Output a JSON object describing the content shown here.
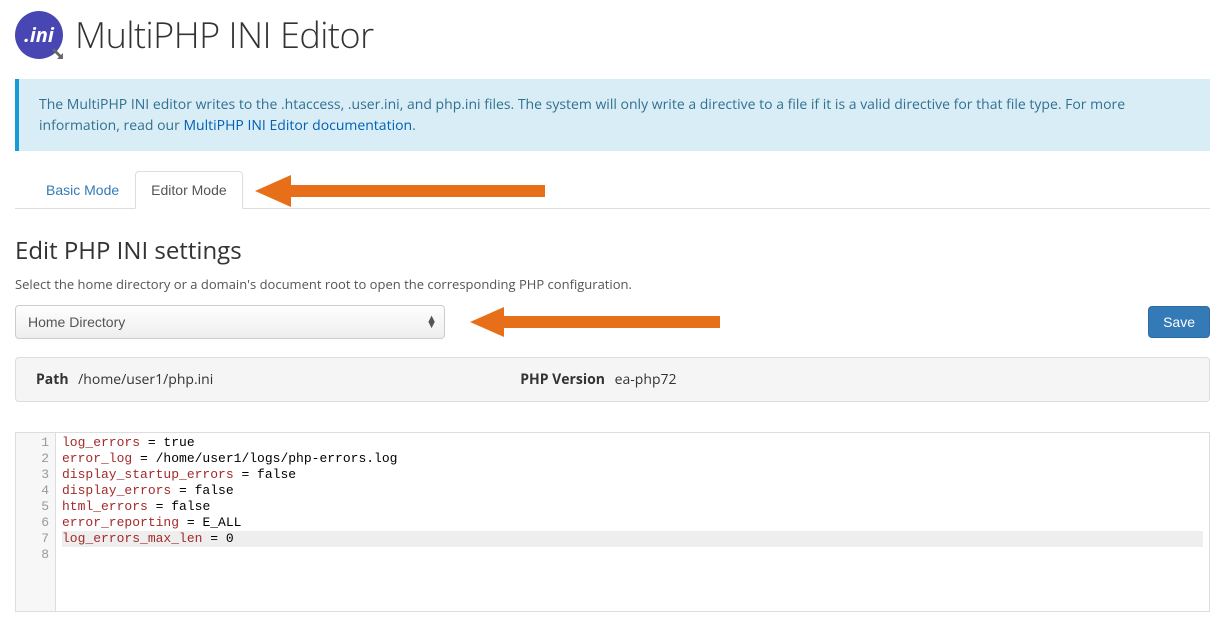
{
  "header": {
    "icon_text": ".ini",
    "title": "MultiPHP INI Editor"
  },
  "alert": {
    "text_pre": "The MultiPHP INI editor writes to the .htaccess, .user.ini, and php.ini files. The system will only write a directive to a file if it is a valid directive for that file type. For more information, read our ",
    "link_text": "MultiPHP INI Editor documentation",
    "text_post": "."
  },
  "tabs": {
    "basic": "Basic Mode",
    "editor": "Editor Mode"
  },
  "section": {
    "title": "Edit PHP INI settings",
    "help": "Select the home directory or a domain's document root to open the corresponding PHP configuration."
  },
  "select": {
    "value": "Home Directory"
  },
  "buttons": {
    "save": "Save"
  },
  "infobar": {
    "path_label": "Path",
    "path_value": "/home/user1/php.ini",
    "ver_label": "PHP Version",
    "ver_value": "ea-php72"
  },
  "editor_lines": [
    {
      "n": "1",
      "key": "log_errors",
      "op": " = ",
      "val": "true",
      "hl": false
    },
    {
      "n": "2",
      "key": "error_log",
      "op": " = ",
      "val": "/home/user1/logs/php-errors.log",
      "hl": false
    },
    {
      "n": "3",
      "key": "display_startup_errors",
      "op": " = ",
      "val": "false",
      "hl": false
    },
    {
      "n": "4",
      "key": "display_errors",
      "op": " = ",
      "val": "false",
      "hl": false
    },
    {
      "n": "5",
      "key": "html_errors",
      "op": " = ",
      "val": "false",
      "hl": false
    },
    {
      "n": "6",
      "key": "error_reporting",
      "op": " = ",
      "val": "E_ALL",
      "hl": false
    },
    {
      "n": "7",
      "key": "log_errors_max_len",
      "op": " = ",
      "val": "0",
      "hl": true
    },
    {
      "n": "8",
      "key": "",
      "op": "",
      "val": "",
      "hl": false
    }
  ]
}
